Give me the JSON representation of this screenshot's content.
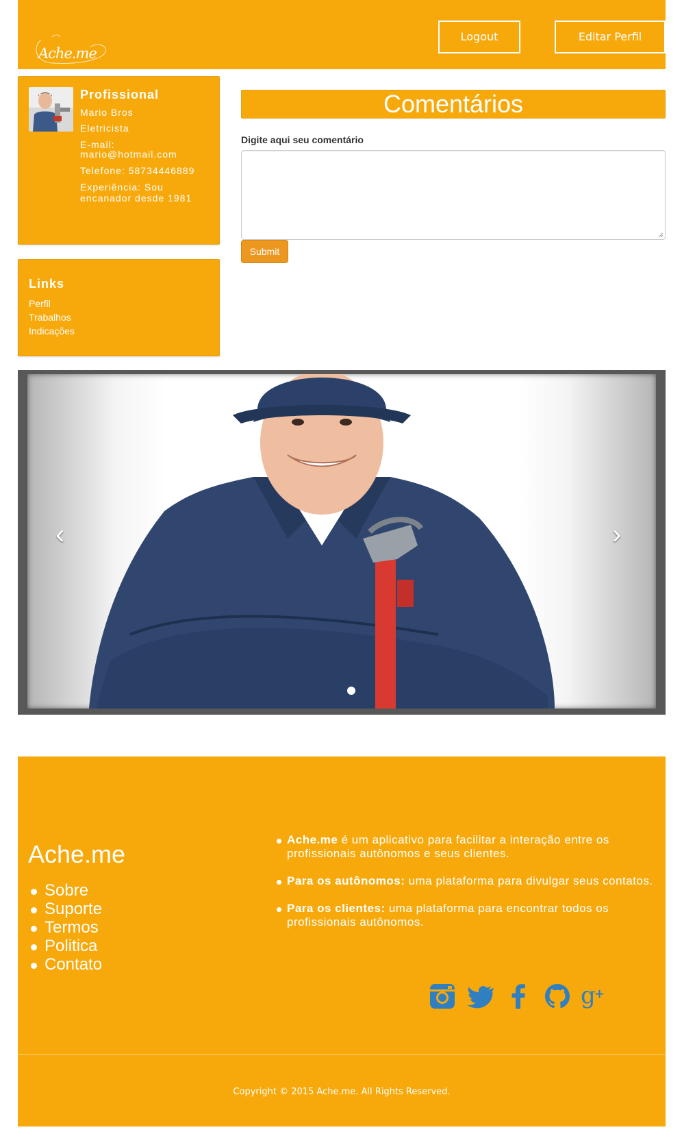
{
  "header": {
    "logo_text": "Ache.me",
    "logout_label": "Logout",
    "edit_profile_label": "Editar Perfil"
  },
  "profile": {
    "title": "Profissional",
    "name": "Mario Bros",
    "profession": "Eletricista",
    "email_label": "E-mail:",
    "email": "mario@hotmail.com",
    "phone": "Telefone: 58734446889",
    "experience": "Experiência: Sou encanador desde 1981"
  },
  "links": {
    "title": "Links",
    "items": [
      "Perfil",
      "Trabalhos",
      "Indicações"
    ]
  },
  "comments": {
    "title": "Comentários",
    "label": "Digite aqui seu comentário",
    "textarea_value": "",
    "submit_label": "Submit"
  },
  "carousel": {
    "prev_icon": "chevron-left-icon",
    "next_icon": "chevron-right-icon",
    "active_slide": 1,
    "slide_count": 1
  },
  "footer": {
    "brand": "Ache.me",
    "links": [
      "Sobre",
      "Suporte",
      "Termos",
      "Politica",
      "Contato"
    ],
    "about": [
      {
        "bold": "Ache.me",
        "text": " é um aplicativo para facilitar a interação entre os profissionais autônomos e seus clientes."
      },
      {
        "bold": "Para os autônomos:",
        "text": " uma plataforma para divulgar seus contatos."
      },
      {
        "bold": "Para os clientes:",
        "text": " uma plataforma para encontrar todos os profissionais autônomos."
      }
    ],
    "socials": [
      "instagram-icon",
      "twitter-icon",
      "facebook-icon",
      "github-icon",
      "google-plus-icon"
    ],
    "social_color": "#2f7fc1",
    "copyright": "Copyright © 2015 Ache.me. All Rights Reserved."
  },
  "colors": {
    "brand": "#f7a90b",
    "submit": "#ec971f"
  }
}
